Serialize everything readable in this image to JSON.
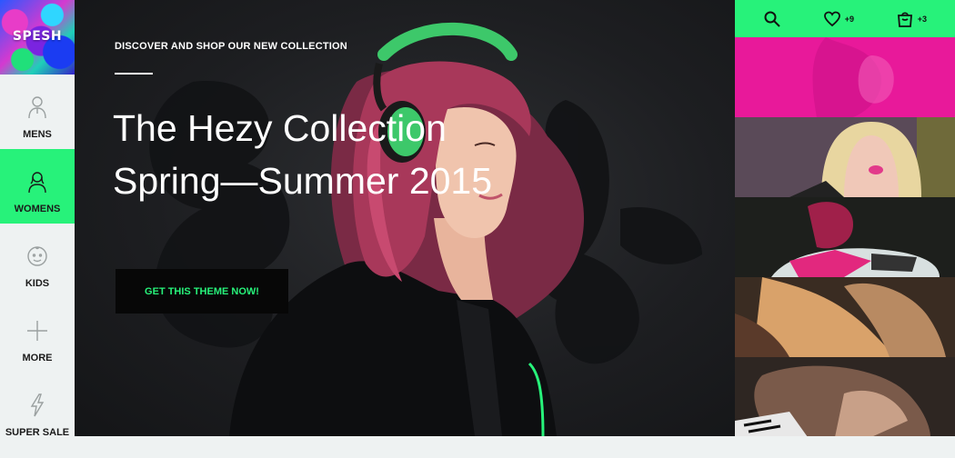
{
  "brand": {
    "logo_text": "SPESH"
  },
  "sidebar": {
    "items": [
      {
        "label": "MENS",
        "icon": "man-icon",
        "active": false
      },
      {
        "label": "WOMENS",
        "icon": "woman-icon",
        "active": true
      },
      {
        "label": "KIDS",
        "icon": "kid-icon",
        "active": false
      },
      {
        "label": "MORE",
        "icon": "plus-icon",
        "active": false
      },
      {
        "label": "SUPER SALE",
        "icon": "lightning-icon",
        "active": false
      }
    ]
  },
  "hero": {
    "kicker": "DISCOVER AND SHOP OUR NEW COLLECTION",
    "title_line1": "The Hezy Collection",
    "title_line2": "Spring—Summer 2015",
    "cta_label": "GET THIS THEME NOW!"
  },
  "topbar": {
    "wishlist_count": "+9",
    "cart_count": "+3"
  },
  "colors": {
    "accent": "#27f27a",
    "magenta": "#e8199a",
    "dark": "#070707"
  }
}
